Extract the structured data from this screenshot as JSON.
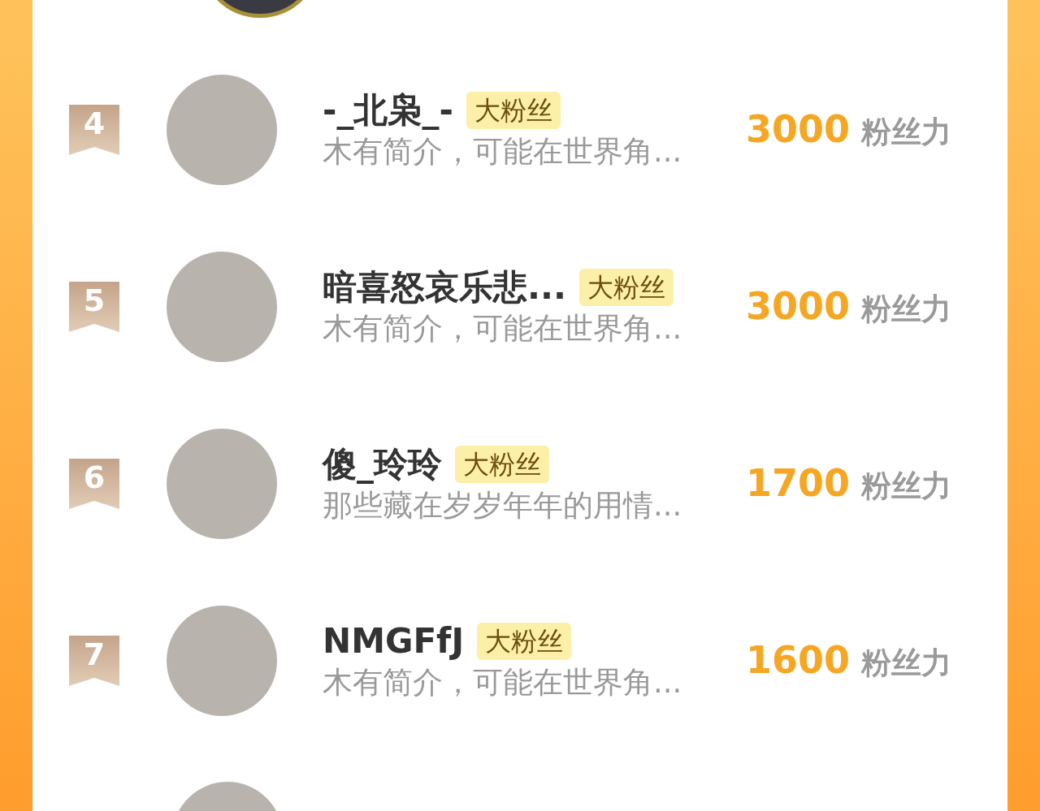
{
  "rows": [
    {
      "rank": "4",
      "name": "-_北枭_-",
      "badge": "大粉丝",
      "bio": "木有简介，可能在世界角...",
      "score": "3000",
      "score_unit": "粉丝力"
    },
    {
      "rank": "5",
      "name": "暗喜怒哀乐悲...",
      "badge": "大粉丝",
      "bio": "木有简介，可能在世界角...",
      "score": "3000",
      "score_unit": "粉丝力"
    },
    {
      "rank": "6",
      "name": "傻_玲玲",
      "badge": "大粉丝",
      "bio": "那些藏在岁岁年年的用情...",
      "score": "1700",
      "score_unit": "粉丝力"
    },
    {
      "rank": "7",
      "name": "NMGFfJ",
      "badge": "大粉丝",
      "bio": "木有简介，可能在世界角...",
      "score": "1600",
      "score_unit": "粉丝力"
    }
  ]
}
